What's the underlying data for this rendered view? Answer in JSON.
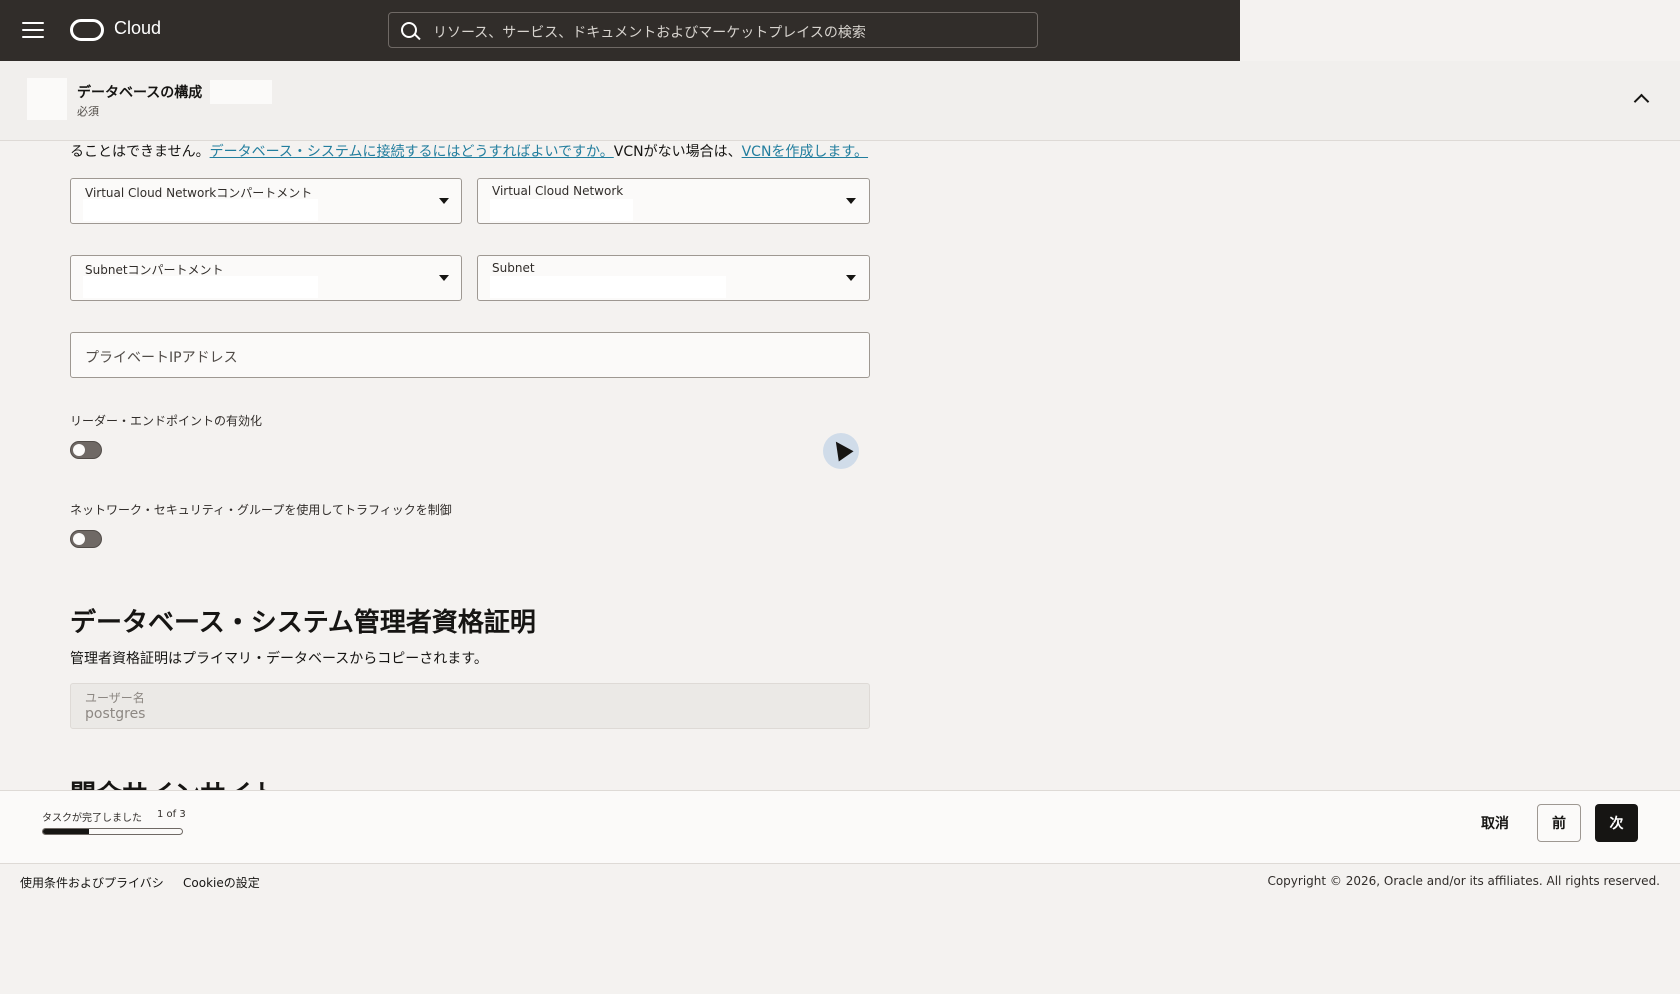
{
  "topbar": {
    "logo_text": "Cloud",
    "search_placeholder": "リソース、サービス、ドキュメントおよびマーケットプレイスの検索"
  },
  "header": {
    "title": "データベースの構成",
    "subtitle": "必須"
  },
  "intro": {
    "text_before": "ることはできません。",
    "link1": "データベース・システムに接続するにはどうすればよいですか。",
    "text_middle": "VCNがない場合は、",
    "link2": "VCNを作成します。"
  },
  "fields": {
    "vcn_compartment_label": "Virtual Cloud Networkコンパートメント",
    "vcn_label": "Virtual Cloud Network",
    "subnet_compartment_label": "Subnetコンパートメント",
    "subnet_label": "Subnet",
    "private_ip_label": "プライベートIPアドレス"
  },
  "toggles": {
    "reader_endpoint_label": "リーダー・エンドポイントの有効化",
    "reader_endpoint_on": false,
    "nsg_label": "ネットワーク・セキュリティ・グループを使用してトラフィックを制御",
    "nsg_on": false
  },
  "credentials": {
    "heading": "データベース・システム管理者資格証明",
    "description": "管理者資格証明はプライマリ・データベースからコピーされます。",
    "username_label": "ユーザー名",
    "username_value": "postgres"
  },
  "next_section": {
    "heading": "関介サインサイト"
  },
  "progress": {
    "label": "タスクが完了しました",
    "count": "1 of 3",
    "fraction": 0.333
  },
  "actions": {
    "cancel": "取消",
    "previous": "前",
    "next": "次"
  },
  "footer": {
    "terms": "使用条件およびプライバシ",
    "cookies": "Cookieの設定",
    "copyright": "Copyright © 2026, Oracle and/or its affiliates. All rights reserved."
  },
  "colors": {
    "topbar": "#312d2a",
    "link": "#227e9e",
    "primary_button": "#161513"
  }
}
